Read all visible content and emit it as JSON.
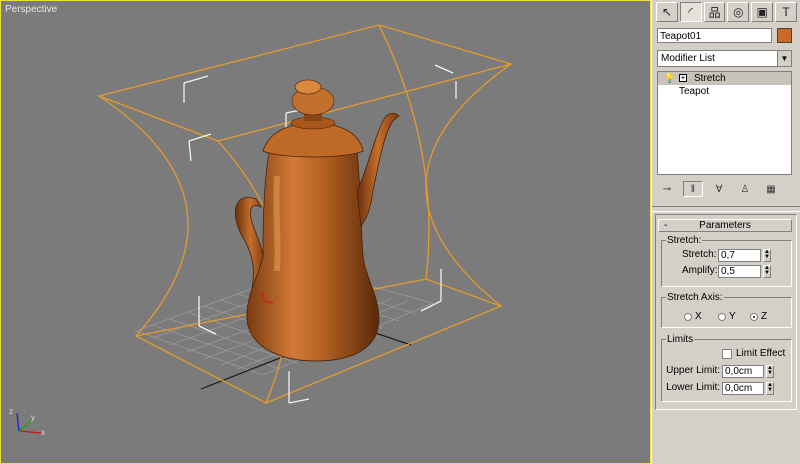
{
  "viewport": {
    "label": "Perspective"
  },
  "command_panel": {
    "tabs": [
      {
        "name": "create",
        "glyph": "↖"
      },
      {
        "name": "modify",
        "glyph": "◜"
      },
      {
        "name": "hierarchy",
        "glyph": "品"
      },
      {
        "name": "motion",
        "glyph": "◎"
      },
      {
        "name": "display",
        "glyph": "▣"
      },
      {
        "name": "utilities",
        "glyph": "T"
      }
    ],
    "object_name": "Teapot01",
    "object_color": "#c96a26",
    "modifier_list_label": "Modifier List",
    "stack": [
      {
        "label": "Stretch",
        "selected": true,
        "has_bulb": true,
        "has_plus": true
      },
      {
        "label": "Teapot",
        "selected": false
      }
    ],
    "stack_tools": [
      "pin-stack",
      "show-end-result",
      "make-unique",
      "remove-modifier",
      "configure-modifier-sets"
    ],
    "parameters": {
      "title": "Parameters",
      "collapse_glyph": "-",
      "stretch_group": {
        "legend": "Stretch:",
        "stretch_label": "Stretch:",
        "stretch_value": "0,7",
        "amplify_label": "Amplify:",
        "amplify_value": "0,5"
      },
      "axis_group": {
        "legend": "Stretch Axis:",
        "options": [
          "X",
          "Y",
          "Z"
        ],
        "selected": "Z"
      },
      "limits_group": {
        "legend": "Limits",
        "limit_effect_label": "Limit Effect",
        "limit_effect_checked": false,
        "upper_label": "Upper Limit:",
        "upper_value": "0,0cm",
        "lower_label": "Lower Limit:",
        "lower_value": "0,0cm"
      }
    }
  }
}
